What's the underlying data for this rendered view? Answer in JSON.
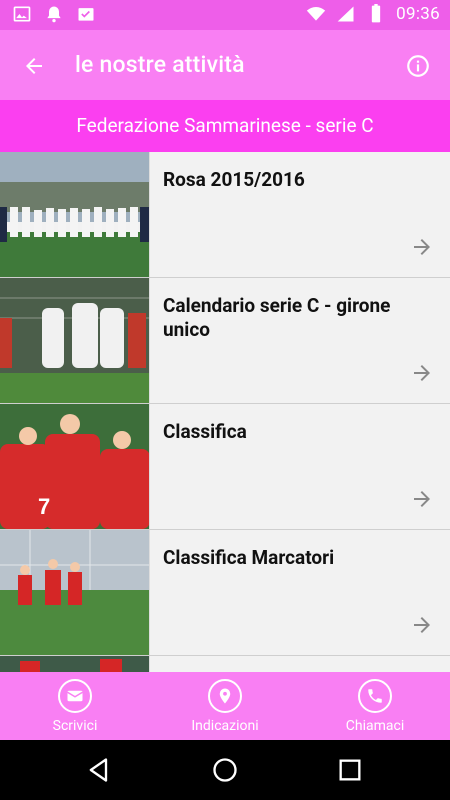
{
  "status_bar": {
    "time": "09:36",
    "left_icons": [
      "image-icon",
      "bell-icon",
      "task-icon"
    ],
    "right_icons": [
      "wifi-icon",
      "signal-icon",
      "battery-icon"
    ]
  },
  "app_bar": {
    "title": "le nostre attività",
    "back_icon": "arrow-left-icon",
    "info_icon": "info-icon"
  },
  "subheader": {
    "text": "Federazione Sammarinese - serie C"
  },
  "list": {
    "items": [
      {
        "label": "Rosa 2015/2016",
        "thumb": "team-photo"
      },
      {
        "label": "Calendario serie C - girone unico",
        "thumb": "celebration-photo"
      },
      {
        "label": "Classifica",
        "thumb": "huddle-photo"
      },
      {
        "label": "Classifica Marcatori",
        "thumb": "match-photo"
      }
    ]
  },
  "actions": [
    {
      "label": "Scrivici",
      "icon": "mail-icon"
    },
    {
      "label": "Indicazioni",
      "icon": "location-pin-icon"
    },
    {
      "label": "Chiamaci",
      "icon": "phone-icon"
    }
  ],
  "colors": {
    "status_bar": "#ee5ee9",
    "app_bar": "#f97ff3",
    "subheader": "#fb3ff0",
    "action_bar": "#f97ff3"
  }
}
